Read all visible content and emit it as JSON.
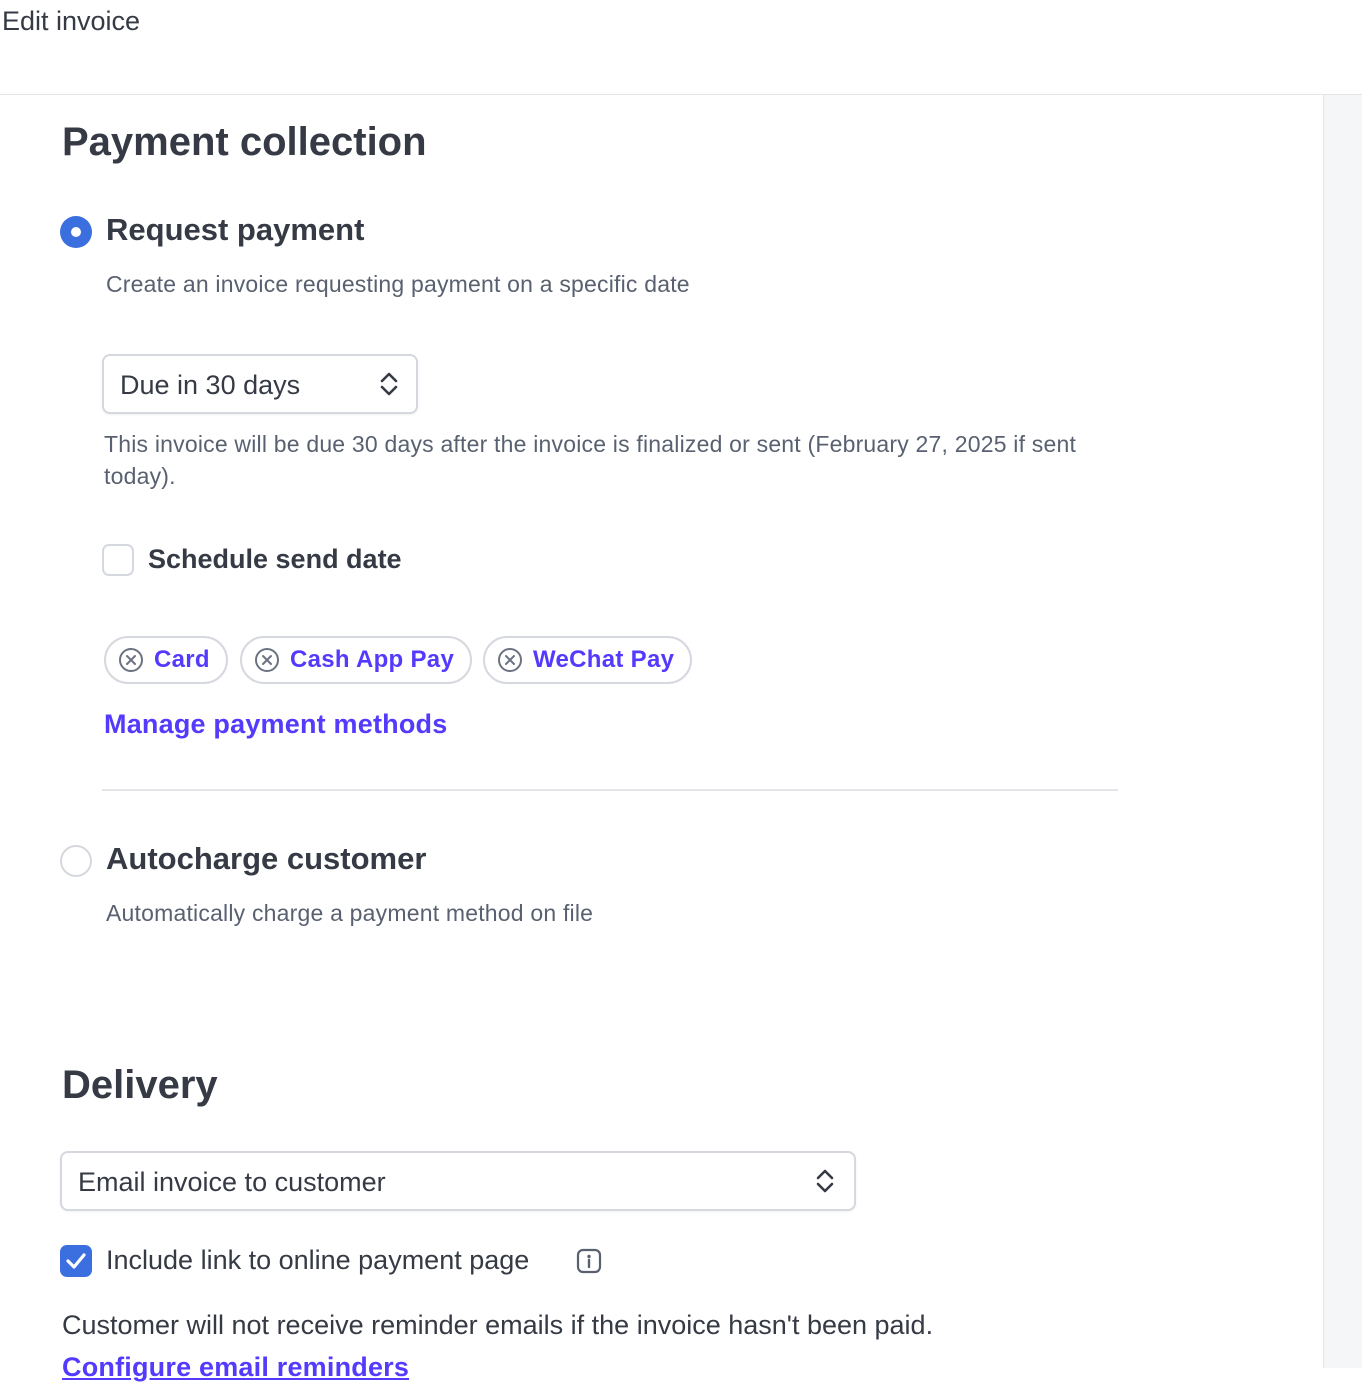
{
  "window": {
    "title": "Edit invoice"
  },
  "payment_collection": {
    "heading": "Payment collection",
    "request_payment": {
      "title": "Request payment",
      "description": "Create an invoice requesting payment on a specific date",
      "selected": true,
      "due_select": {
        "value": "Due in 30 days"
      },
      "helper_text": "This invoice will be due 30 days after the invoice is finalized or sent (February 27, 2025 if sent today).",
      "schedule": {
        "label": "Schedule send date",
        "checked": false
      },
      "payment_methods": [
        {
          "label": "Card",
          "icon": "remove-circle-icon"
        },
        {
          "label": "Cash App Pay",
          "icon": "remove-circle-icon"
        },
        {
          "label": "WeChat Pay",
          "icon": "remove-circle-icon"
        }
      ],
      "manage_link": "Manage payment methods"
    },
    "autocharge": {
      "title": "Autocharge customer",
      "description": "Automatically charge a payment method on file",
      "selected": false
    }
  },
  "delivery": {
    "heading": "Delivery",
    "method_select": {
      "value": "Email invoice to customer"
    },
    "include_link": {
      "label": "Include link to online payment page",
      "checked": true,
      "icon": "info-icon"
    },
    "reminder_note": "Customer will not receive reminder emails if the invoice hasn't been paid.",
    "configure_link": "Configure email reminders"
  },
  "colors": {
    "accent": "#533afd",
    "radio_checked": "#3b6fe0",
    "text": "#353a44",
    "muted": "#596171",
    "border": "#d5d8de"
  }
}
